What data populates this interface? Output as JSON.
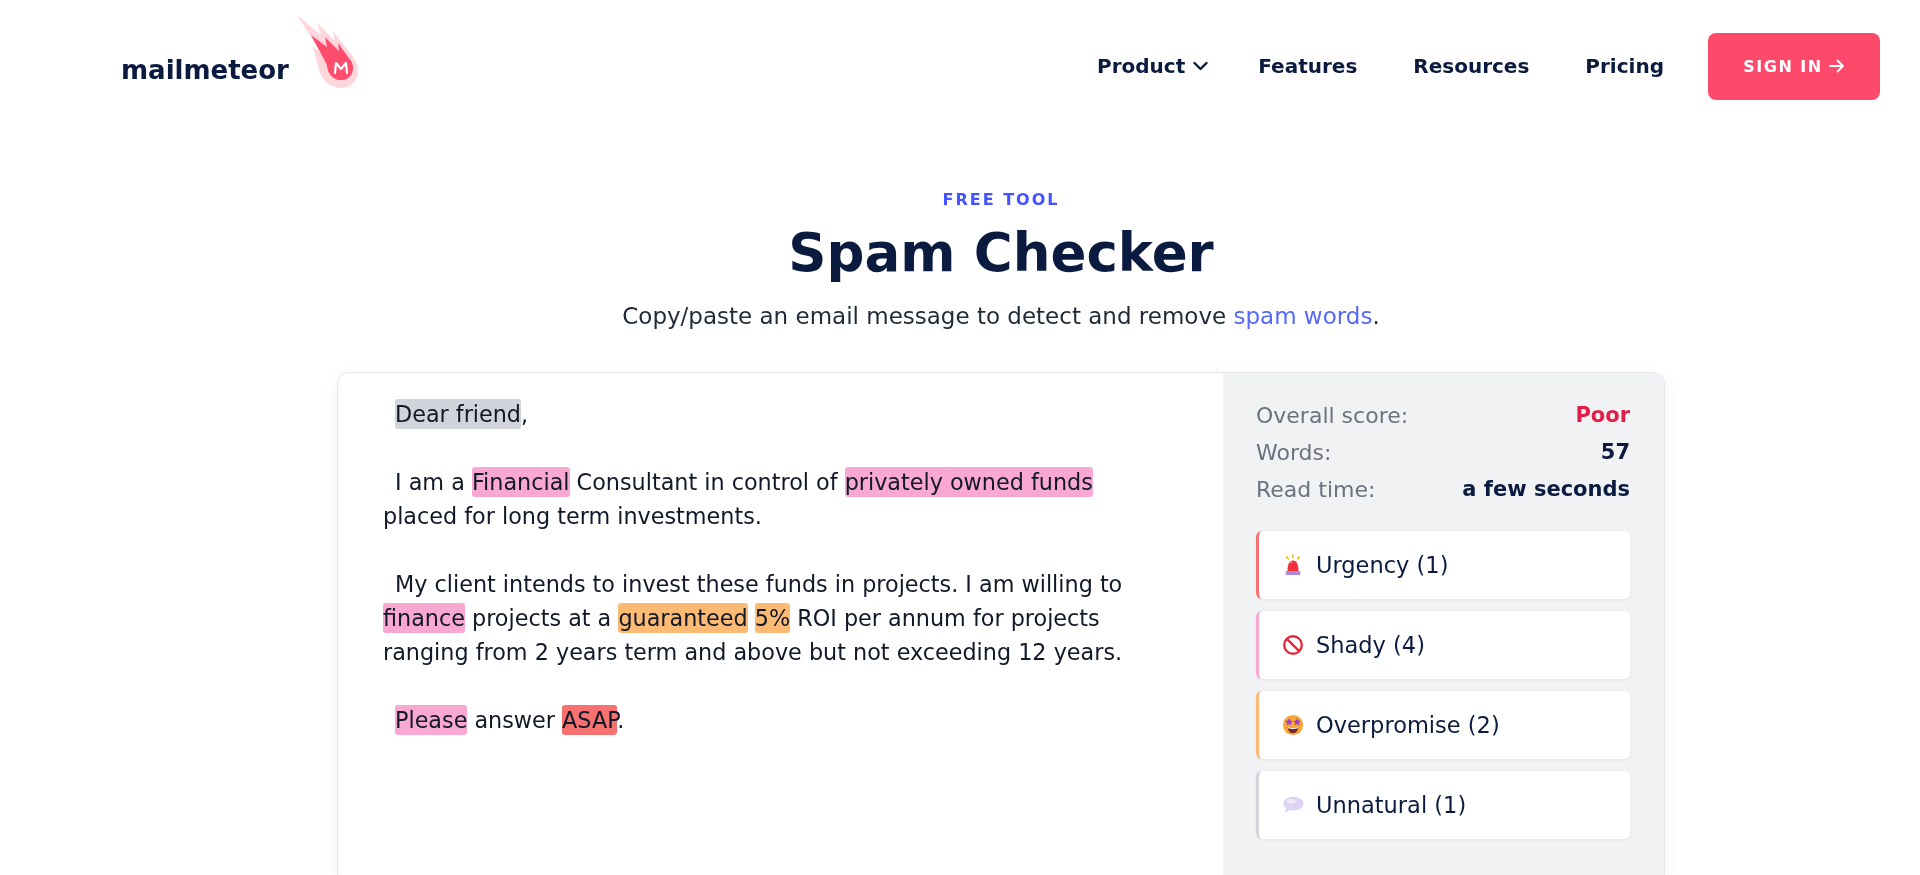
{
  "header": {
    "logo": {
      "text": "mailmeteor"
    },
    "nav": [
      {
        "label": "Product",
        "kind": "dropdown"
      },
      {
        "label": "Features",
        "kind": "link"
      },
      {
        "label": "Resources",
        "kind": "link"
      },
      {
        "label": "Pricing",
        "kind": "link"
      }
    ],
    "sign_in": {
      "label": "SIGN IN"
    }
  },
  "hero": {
    "eyebrow": "FREE TOOL",
    "title": "Spam Checker",
    "subtitle": {
      "text_before": "Copy/paste an email message to detect and remove ",
      "link": "spam words",
      "text_after": "."
    }
  },
  "editor": {
    "paragraphs": [
      {
        "segments": [
          {
            "text": "Dear friend",
            "color": "#d1d5db"
          },
          {
            "text": ","
          }
        ]
      },
      {
        "segments": [
          {
            "text": "I am a "
          },
          {
            "text": "Financial",
            "color": "#f9a8d4"
          },
          {
            "text": " Consultant in control of "
          },
          {
            "text": "privately owned funds",
            "color": "#f9a8d4"
          },
          {
            "text": " placed for long term investments."
          }
        ]
      },
      {
        "segments": [
          {
            "text": "My client intends to invest these funds in projects. I am willing to "
          },
          {
            "text": "finance",
            "color": "#f9a8d4"
          },
          {
            "text": " projects at a "
          },
          {
            "text": "guaranteed",
            "color": "#fdba74"
          },
          {
            "text": "5%",
            "color": "#fdba74"
          },
          {
            "text": " ROI per annum for projects ranging from 2 years term and above but not exceeding 12 years."
          }
        ]
      },
      {
        "segments": [
          {
            "text": "Please",
            "color": "#f9a8d4"
          },
          {
            "text": " answer "
          },
          {
            "text": "ASAP",
            "color": "#f87171"
          },
          {
            "text": "."
          }
        ]
      }
    ]
  },
  "results": {
    "stats": [
      {
        "label": "Overall score:",
        "value": "Poor",
        "kind": "rating"
      },
      {
        "label": "Words:",
        "value": "57",
        "kind": "plain"
      },
      {
        "label": "Read time:",
        "value": "a few seconds",
        "kind": "plain"
      }
    ],
    "categories": [
      {
        "label": "Urgency (1)",
        "kind": "siren",
        "color": "#f87171"
      },
      {
        "label": "Shady (4)",
        "kind": "prohibited",
        "color": "#f9a8d4"
      },
      {
        "label": "Overpromise (2)",
        "kind": "star-struck",
        "color": "#fdba74"
      },
      {
        "label": "Unnatural (1)",
        "kind": "speech",
        "color": "#d1d5db"
      }
    ]
  }
}
